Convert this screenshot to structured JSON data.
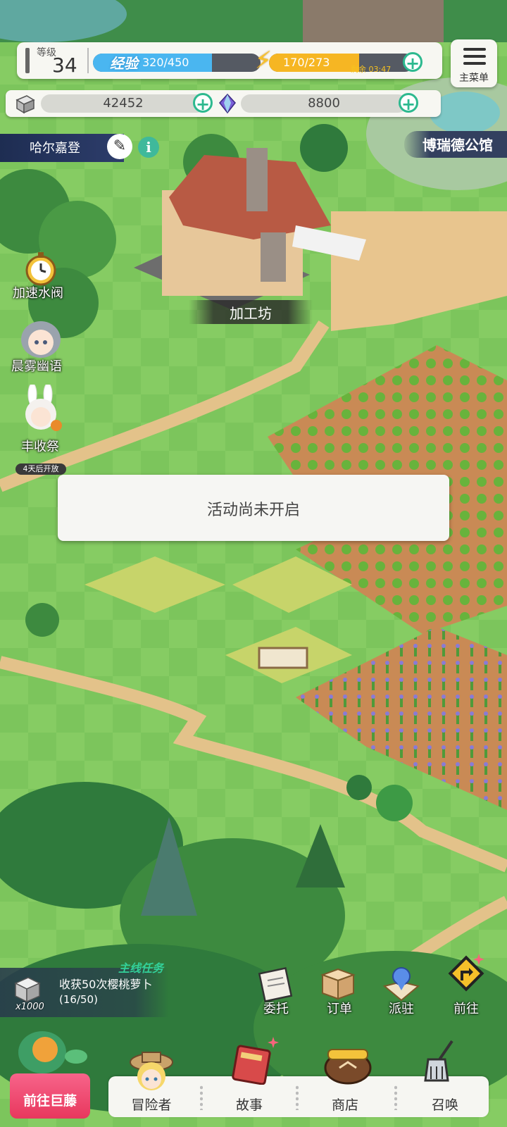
{
  "status": {
    "level_label": "等级",
    "level": "34",
    "exp_label": "经验",
    "exp_text": "320/450",
    "exp_fraction": 0.711,
    "energy_text": "170/273",
    "energy_fraction": 0.623,
    "energy_remain": "剩余 03:47"
  },
  "currency": {
    "gold": "42452",
    "crystal": "8800"
  },
  "menu": {
    "label": "主菜单"
  },
  "location": {
    "name": "哈尔嘉登",
    "landmark": "博瑞德公馆",
    "workshop": "加工坊"
  },
  "side_features": {
    "valve": "加速水阀",
    "mist": "晨雾幽语",
    "harvest": "丰收祭",
    "harvest_sub": "4天后开放"
  },
  "toast": {
    "message": "活动尚未开启"
  },
  "quest": {
    "tag": "主线任务",
    "text": "收获50次樱桃萝卜",
    "progress": "(16/50)",
    "reward": "x1000"
  },
  "actions": {
    "commission": "委托",
    "order": "订单",
    "station": "派驻",
    "go": "前往"
  },
  "bottom_nav": {
    "giant": "前往巨藤",
    "adventurer": "冒险者",
    "story": "故事",
    "shop": "商店",
    "summon": "召唤"
  },
  "colors": {
    "grass": "#7bc45a",
    "exp_bar": "#4ab6f0",
    "energy_bar": "#f6b623",
    "plus_accent": "#2db98f",
    "giant_button": "#e8375d",
    "quest_tag": "#33d19a"
  }
}
